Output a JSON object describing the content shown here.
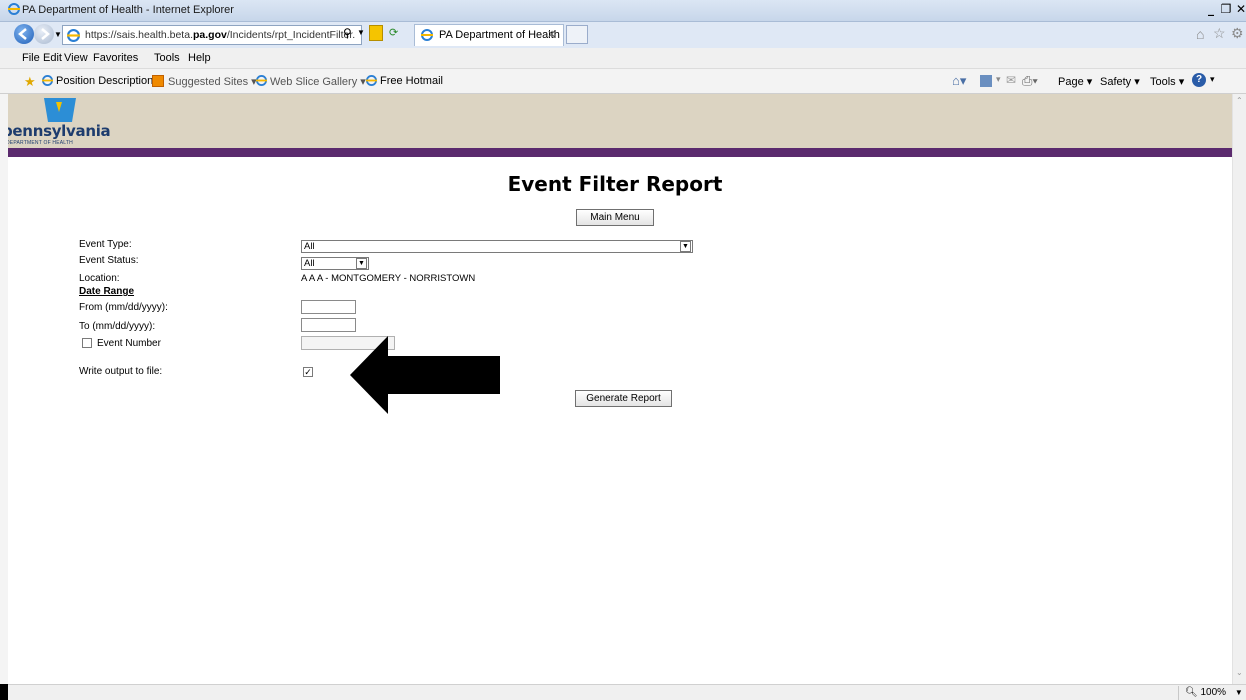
{
  "window": {
    "title": "PA Department of Health - Internet Explorer",
    "url_prefix": "https://sais.health.beta.",
    "url_domain": "pa.gov",
    "url_path": "/Incidents/rpt_IncidentFilter.",
    "tab_title": "PA Department of Health"
  },
  "menu": [
    "File",
    "Edit",
    "View",
    "Favorites",
    "Tools",
    "Help"
  ],
  "favorites": [
    "Position Description",
    "Suggested Sites ▾",
    "Web Slice Gallery ▾",
    "Free Hotmail"
  ],
  "commandbar": {
    "page": "Page ▾",
    "safety": "Safety ▾",
    "tools": "Tools ▾"
  },
  "header": {
    "logo_text": "pennsylvania",
    "logo_sub": "DEPARTMENT OF HEALTH",
    "banner_color": "#dcd4c2",
    "bar_color": "#5b2a6e"
  },
  "page": {
    "title": "Event Filter Report",
    "main_menu_button": "Main Menu",
    "generate_button": "Generate Report",
    "fields": {
      "event_type_label": "Event Type:",
      "event_type_value": "All",
      "event_status_label": "Event Status:",
      "event_status_value": "All",
      "location_label": "Location:",
      "location_value": "A A A - MONTGOMERY - NORRISTOWN",
      "date_range_label": "Date Range",
      "from_label": "From (mm/dd/yyyy):",
      "from_value": "",
      "to_label": "To (mm/dd/yyyy):",
      "to_value": "",
      "event_number_label": "Event Number",
      "event_number_checked": false,
      "write_output_label": "Write output to file:",
      "write_output_checked": true
    }
  },
  "status": {
    "zoom": "100%"
  }
}
